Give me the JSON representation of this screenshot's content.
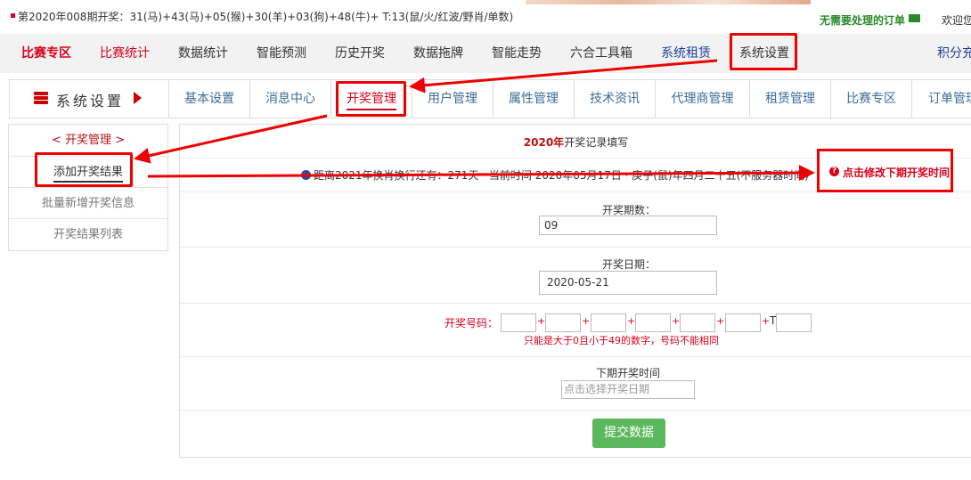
{
  "topbar": {
    "lottery_info": "第2020年008期开奖：31(马)+43(马)+05(猴)+30(羊)+03(狗)+48(牛)+ T:13(鼠/火/红波/野肖/单数)",
    "orders_notice": "无需要处理的订单",
    "welcome": "欢迎您"
  },
  "mainnav": {
    "items": [
      "比赛专区",
      "比赛统计",
      "数据统计",
      "智能预测",
      "历史开奖",
      "数据拖牌",
      "智能走势",
      "六合工具箱",
      "系统租赁",
      "系统设置",
      "积分充"
    ]
  },
  "subnav": {
    "brand": "系统设置",
    "tabs": [
      "基本设置",
      "消息中心",
      "开奖管理",
      "用户管理",
      "属性管理",
      "技术资讯",
      "代理商管理",
      "租赁管理",
      "比赛专区",
      "订单管理"
    ]
  },
  "sidebar": {
    "header": "开奖管理",
    "items": [
      "添加开奖结果",
      "批量新增开奖信息",
      "开奖结果列表"
    ]
  },
  "form": {
    "title_year": "2020年",
    "title_rest": "开奖记录填写",
    "notice": "距离2021年换肖换行还有：271天 · 当前时间 2020年05月17日 · 庚子(鼠)年四月二十五(不服务器时间)",
    "next_time_button": "点击修改下期开奖时间",
    "period_label": "开奖期数：",
    "period_value": "09",
    "date_label": "开奖日期：",
    "date_value": "2020-05-21",
    "numbers_label": "开奖号码：",
    "special_prefix": "T",
    "numbers_hint": "只能是大于0且小于49的数字，号码不能相同",
    "next_label": "下期开奖时间",
    "next_placeholder": "点击选择开奖日期",
    "submit": "提交数据"
  },
  "colors": {
    "accent_red": "#d9001b",
    "nav_blue": "#1f3f9f",
    "link_blue": "#3a6c9a",
    "submit_green": "#5cb85c",
    "orders_green": "#2a8a2a"
  }
}
